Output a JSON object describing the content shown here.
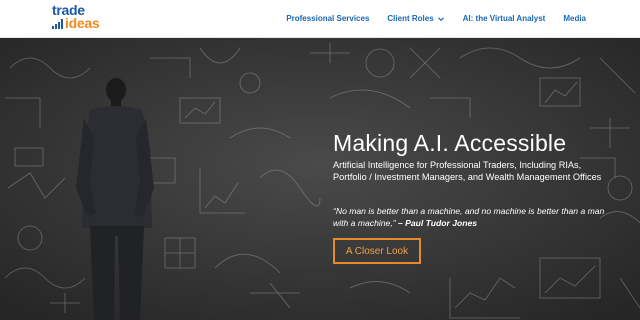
{
  "brand": {
    "logo_line1": "trade",
    "logo_line2": "ideas",
    "colors": {
      "blue": "#1c5aa6",
      "orange": "#f08a1c"
    }
  },
  "nav": {
    "items": [
      {
        "label": "Professional Services",
        "has_dropdown": false
      },
      {
        "label": "Client Roles",
        "has_dropdown": true
      },
      {
        "label": "AI: the Virtual Analyst",
        "has_dropdown": false
      },
      {
        "label": "Media",
        "has_dropdown": false
      }
    ]
  },
  "hero": {
    "title": "Making A.I. Accessible",
    "subtitle": "Artificial Intelligence for Professional Traders, Including RIAs, Portfolio / Investment Managers, and Wealth Management Offices",
    "quote": "“No man is better than a machine, and no machine is better than a man with a machine,”",
    "quote_author": "– Paul Tudor Jones",
    "cta_label": "A Closer Look",
    "background_description_icon": "chalkboard-doodles"
  },
  "colors": {
    "accent": "#e8892a",
    "nav_link": "#1a67b3",
    "hero_bg": "#3b3b3b"
  }
}
